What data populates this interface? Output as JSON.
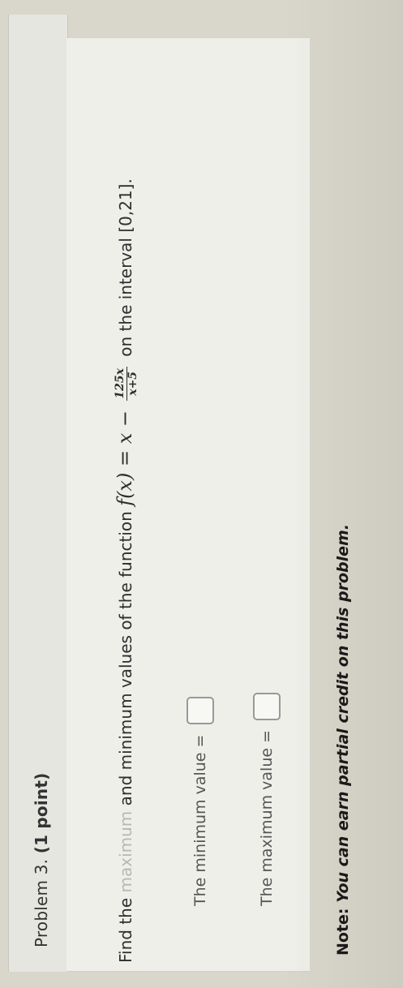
{
  "problem": {
    "title": "Problem 3.",
    "points": "(1 point)"
  },
  "question": {
    "lead_plain": "Find the ",
    "lead_muted": "maximum",
    "middle": " and minimum values of the function ",
    "math_lhs": "f(x) = x −",
    "frac_num": "125x",
    "frac_den": "x+5",
    "tail": "on the interval [0,21]."
  },
  "answers": {
    "min_label": "The minimum value =",
    "max_label": "The maximum value ="
  },
  "note": {
    "label": "Note:",
    "text": "You can earn partial credit on this problem."
  }
}
